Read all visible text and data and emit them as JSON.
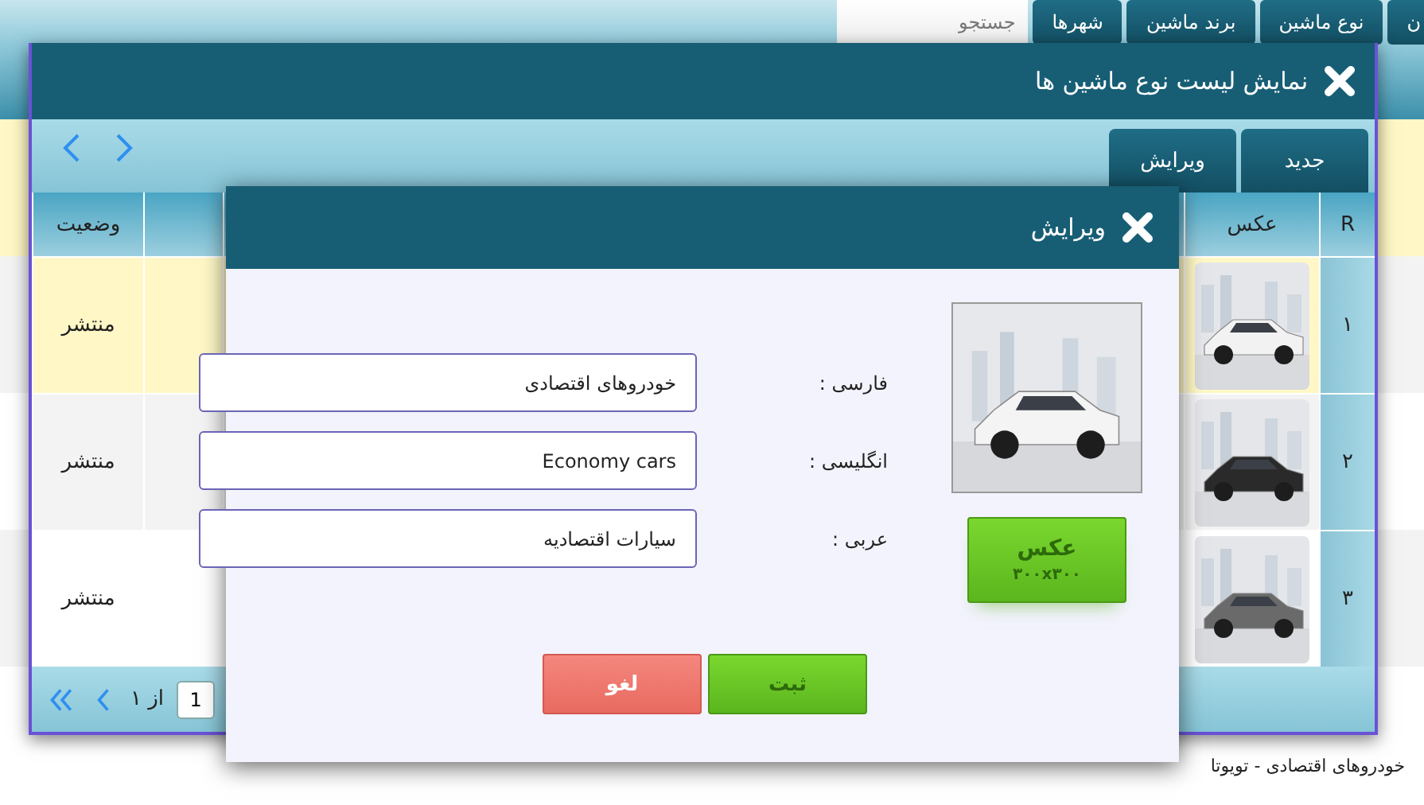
{
  "nav": {
    "tabs": [
      {
        "label": "ن"
      },
      {
        "label": "نوع ماشین"
      },
      {
        "label": "برند ماشین"
      },
      {
        "label": "شهرها"
      }
    ],
    "search": {
      "placeholder": "جستجو"
    }
  },
  "background_text": "خودروهای اقتصادی - تویوتا",
  "list_window": {
    "title": "نمایش لیست نوع ماشین ها",
    "toolbar_buttons": [
      "جدید",
      "ویرایش"
    ],
    "columns": [
      {
        "label": "R"
      },
      {
        "label": "عکس"
      },
      {
        "label": "وضعیت"
      }
    ],
    "rows": [
      {
        "number": "۱",
        "status": "منتشر",
        "selected": true
      },
      {
        "number": "۲",
        "status": "منتشر",
        "selected": false
      },
      {
        "number": "۳",
        "status": "منتشر",
        "selected": false
      }
    ],
    "pager": {
      "page": "1",
      "of": "از ۱"
    }
  },
  "edit_dialog": {
    "title": "ویرایش",
    "fields": [
      {
        "label": "فارسی :",
        "value": "خودروهای اقتصادی"
      },
      {
        "label": "انگلیسی :",
        "value": "Economy cars"
      },
      {
        "label": "عربی :",
        "value": "سیارات اقتصادیه"
      }
    ],
    "photo_button": {
      "label": "عکس",
      "size": "۳۰۰x۳۰۰"
    },
    "buttons": [
      {
        "label": "ثبت",
        "kind": "primary"
      },
      {
        "label": "لغو",
        "kind": "cancel"
      }
    ]
  }
}
